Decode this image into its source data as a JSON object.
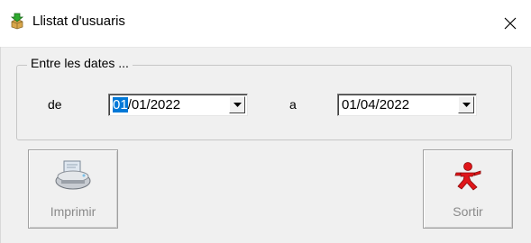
{
  "window": {
    "title": "Llistat d'usuaris",
    "icon": "green-arrow-box-icon",
    "close_icon": "close-icon"
  },
  "group": {
    "legend": "Entre les dates ..."
  },
  "date_from": {
    "label": "de",
    "value_selected_part": "01",
    "value_rest": "/01/2022",
    "selected_color": "#0078d7"
  },
  "date_to": {
    "label": "a",
    "value": "01/04/2022"
  },
  "buttons": {
    "print": {
      "label": "Imprimir",
      "icon": "printer-icon",
      "enabled": false
    },
    "exit": {
      "label": "Sortir",
      "icon": "running-man-icon",
      "enabled": false
    }
  }
}
